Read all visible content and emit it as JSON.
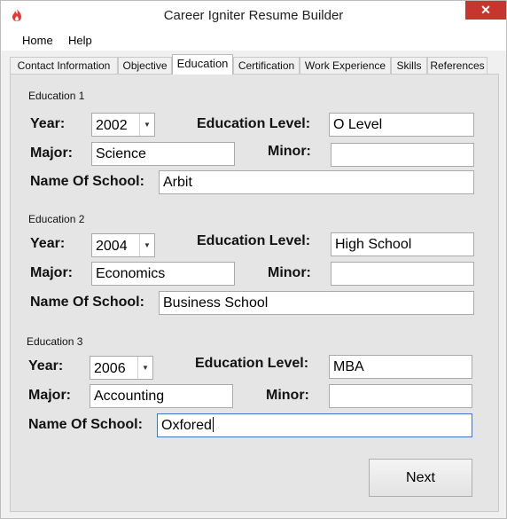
{
  "window": {
    "title": "Career Igniter Resume Builder",
    "close_label": "✕",
    "app_icon": "flame-icon"
  },
  "menu": [
    "Home",
    "Help"
  ],
  "tabs": [
    "Contact Information",
    "Objective",
    "Education",
    "Certification",
    "Work Experience",
    "Skills",
    "References"
  ],
  "active_tab": "Education",
  "labels": {
    "year": "Year:",
    "education_level": "Education Level:",
    "major": "Major:",
    "minor": "Minor:",
    "school": "Name Of School:"
  },
  "education": [
    {
      "heading": "Education 1",
      "year": "2002",
      "level": "O Level",
      "major": "Science",
      "minor": "",
      "school": "Arbit"
    },
    {
      "heading": "Education 2",
      "year": "2004",
      "level": "High School",
      "major": "Economics",
      "minor": "",
      "school": "Business School"
    },
    {
      "heading": "Education 3",
      "year": "2006",
      "level": "MBA",
      "major": "Accounting",
      "minor": "",
      "school": "Oxfored"
    }
  ],
  "next_label": "Next",
  "colors": {
    "close_button": "#c7352f",
    "panel": "#e5e5e5",
    "focus_border": "#3a79c9",
    "flame": "#e53935"
  }
}
